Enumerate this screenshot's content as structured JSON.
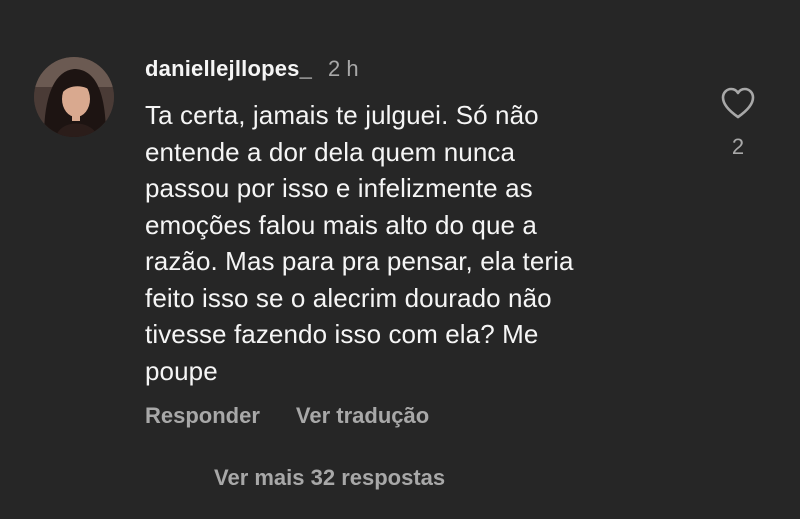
{
  "comment": {
    "username": "daniellejllopes_",
    "time": "2 h",
    "text": "Ta certa, jamais te julguei. Só não\nentende a dor dela quem nunca\npassou por isso e infelizmente as\nemoções falou mais alto do que a\nrazão. Mas para pra pensar, ela teria\nfeito isso se o alecrim dourado não\ntivesse fazendo isso com ela? Me\npoupe",
    "like_count": "2",
    "like_icon": "heart-outline-icon",
    "actions": {
      "reply": "Responder",
      "translate": "Ver tradução"
    },
    "view_replies": "Ver mais 32 respostas"
  },
  "colors": {
    "background": "#262626",
    "primary_text": "#f5f5f5",
    "secondary_text": "#a8a8a8"
  }
}
